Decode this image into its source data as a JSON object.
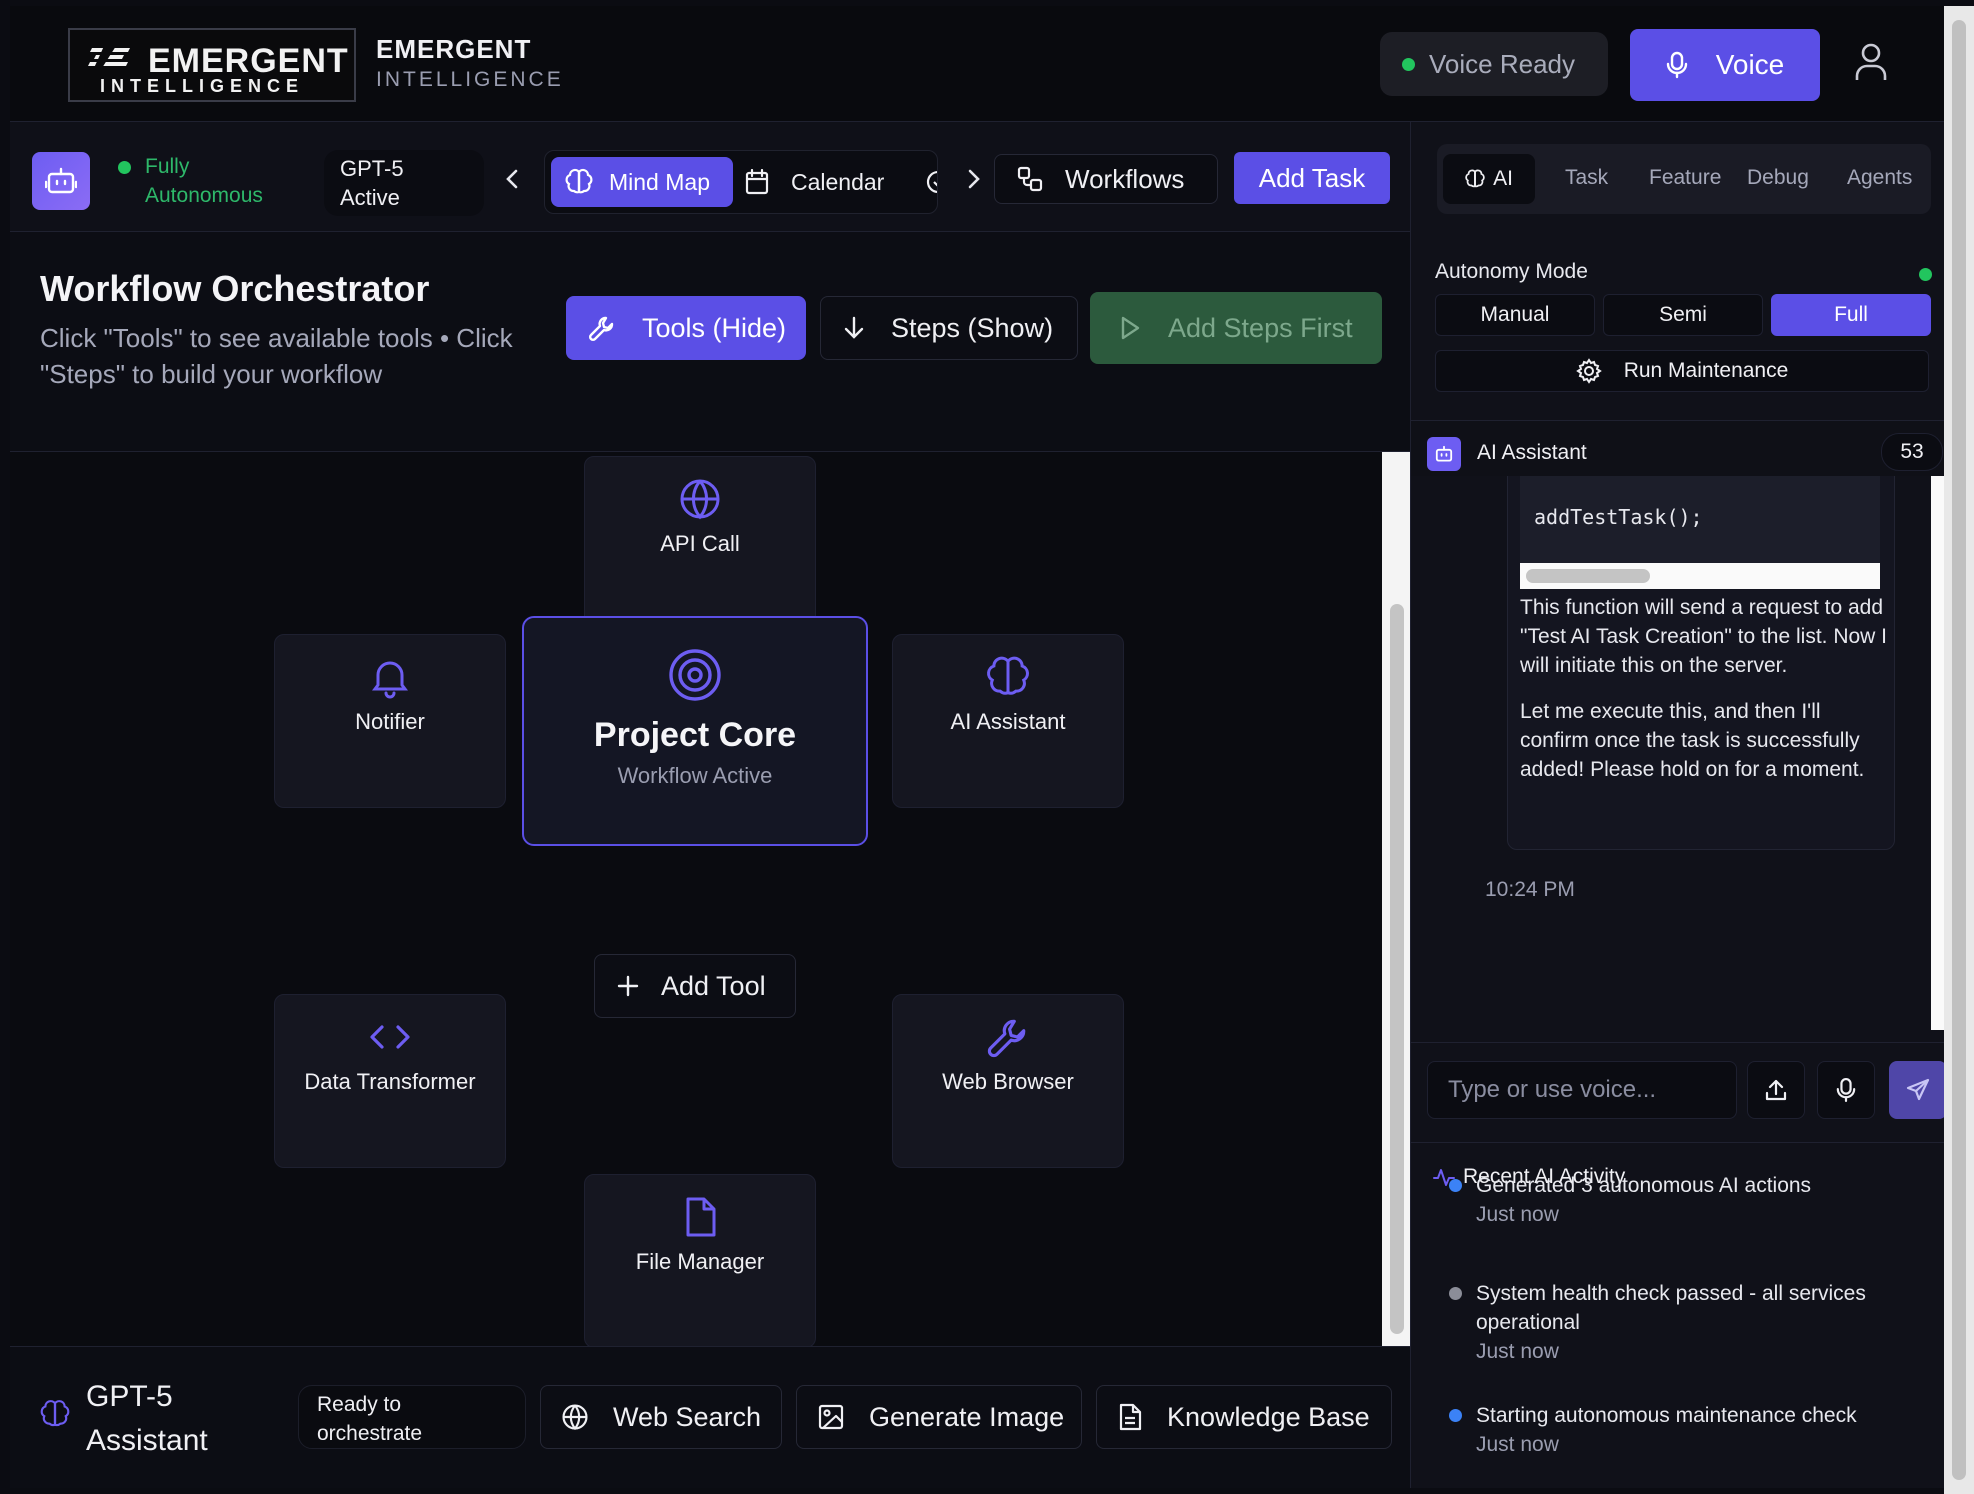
{
  "header": {
    "logo_big": "EMERGENT",
    "logo_small": "INTELLIGENCE",
    "brand_line1": "EMERGENT",
    "brand_line2": "INTELLIGENCE",
    "voice_status": "Voice Ready",
    "voice_button": "Voice"
  },
  "toolbar": {
    "autonomy_status": [
      "Fully",
      "Autonomous"
    ],
    "model_status": [
      "GPT-5",
      "Active"
    ],
    "mind_map": "Mind Map",
    "calendar": "Calendar",
    "workflows": "Workflows",
    "add_task": "Add Task"
  },
  "orchestrator": {
    "title": "Workflow Orchestrator",
    "description": "Click \"Tools\" to see available tools • Click \"Steps\" to build your workflow",
    "tools_button": "Tools (Hide)",
    "steps_button": "Steps (Show)",
    "run_button": "Add Steps First"
  },
  "canvas": {
    "core_title": "Project Core",
    "core_status": "Workflow Active",
    "tools": {
      "api_call": "API Call",
      "notifier": "Notifier",
      "ai_assistant": "AI Assistant",
      "data_transformer": "Data Transformer",
      "web_browser": "Web Browser",
      "file_manager": "File Manager"
    },
    "add_tool": "Add Tool"
  },
  "footer": {
    "assistant_name": [
      "GPT-5",
      "Assistant"
    ],
    "status": [
      "Ready to",
      "orchestrate"
    ],
    "web_search": "Web Search",
    "generate_image": "Generate Image",
    "knowledge_base": "Knowledge Base"
  },
  "right_panel": {
    "tabs": [
      "AI",
      "Task",
      "Feature",
      "Debug",
      "Agents"
    ],
    "autonomy_label": "Autonomy Mode",
    "modes": [
      "Manual",
      "Semi",
      "Full"
    ],
    "active_mode": "Full",
    "maintenance_button": "Run Maintenance",
    "assistant_title": "AI Assistant",
    "message_count": "53",
    "chat": {
      "code": "addTestTask();",
      "paragraph1": "This function will send a request to add \"Test AI Task Creation\" to the list. Now I will initiate this on the server.",
      "paragraph2": "Let me execute this, and then I'll confirm once the task is successfully added! Please hold on for a moment.",
      "timestamp": "10:24 PM"
    },
    "input_placeholder": "Type or use voice...",
    "activity": {
      "title": "Recent AI Activity",
      "items": [
        {
          "text": "Generated 3 autonomous AI actions",
          "time": "Just now",
          "color": "#3b82f6"
        },
        {
          "text": "System health check passed - all services operational",
          "time": "Just now",
          "color": "#8b8d98"
        },
        {
          "text": "Starting autonomous maintenance check",
          "time": "Just now",
          "color": "#3b82f6"
        }
      ]
    }
  },
  "colors": {
    "accent": "#5b4fe6",
    "success": "#22c55e",
    "run_disabled": "#2c5a3d"
  }
}
